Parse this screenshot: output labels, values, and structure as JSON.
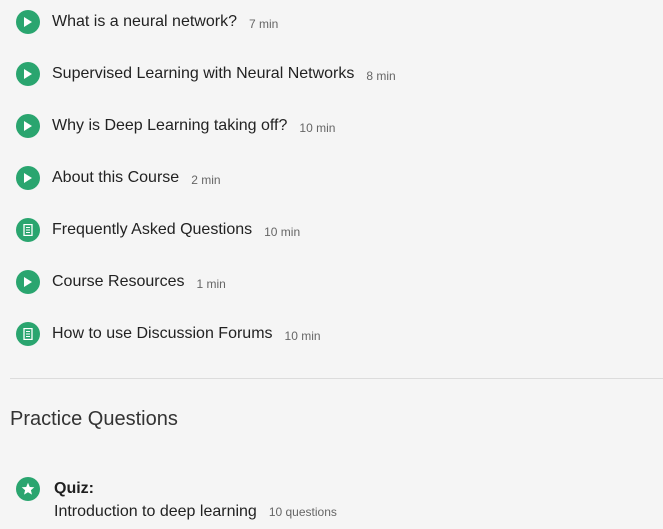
{
  "lessons": [
    {
      "icon": "play-icon",
      "title": "What is a neural network?",
      "duration": "7 min"
    },
    {
      "icon": "play-icon",
      "title": "Supervised Learning with Neural Networks",
      "duration": "8 min"
    },
    {
      "icon": "play-icon",
      "title": "Why is Deep Learning taking off?",
      "duration": "10 min"
    },
    {
      "icon": "play-icon",
      "title": "About this Course",
      "duration": "2 min"
    },
    {
      "icon": "reading-icon",
      "title": "Frequently Asked Questions",
      "duration": "10 min"
    },
    {
      "icon": "play-icon",
      "title": "Course Resources",
      "duration": "1 min"
    },
    {
      "icon": "reading-icon",
      "title": "How to use Discussion Forums",
      "duration": "10 min"
    }
  ],
  "practice": {
    "heading": "Practice Questions",
    "quiz": {
      "icon": "star-icon",
      "label": "Quiz:",
      "title": "Introduction to deep learning",
      "count": "10 questions"
    }
  },
  "colors": {
    "accent": "#2aa56f",
    "background": "#f5f5f5"
  }
}
